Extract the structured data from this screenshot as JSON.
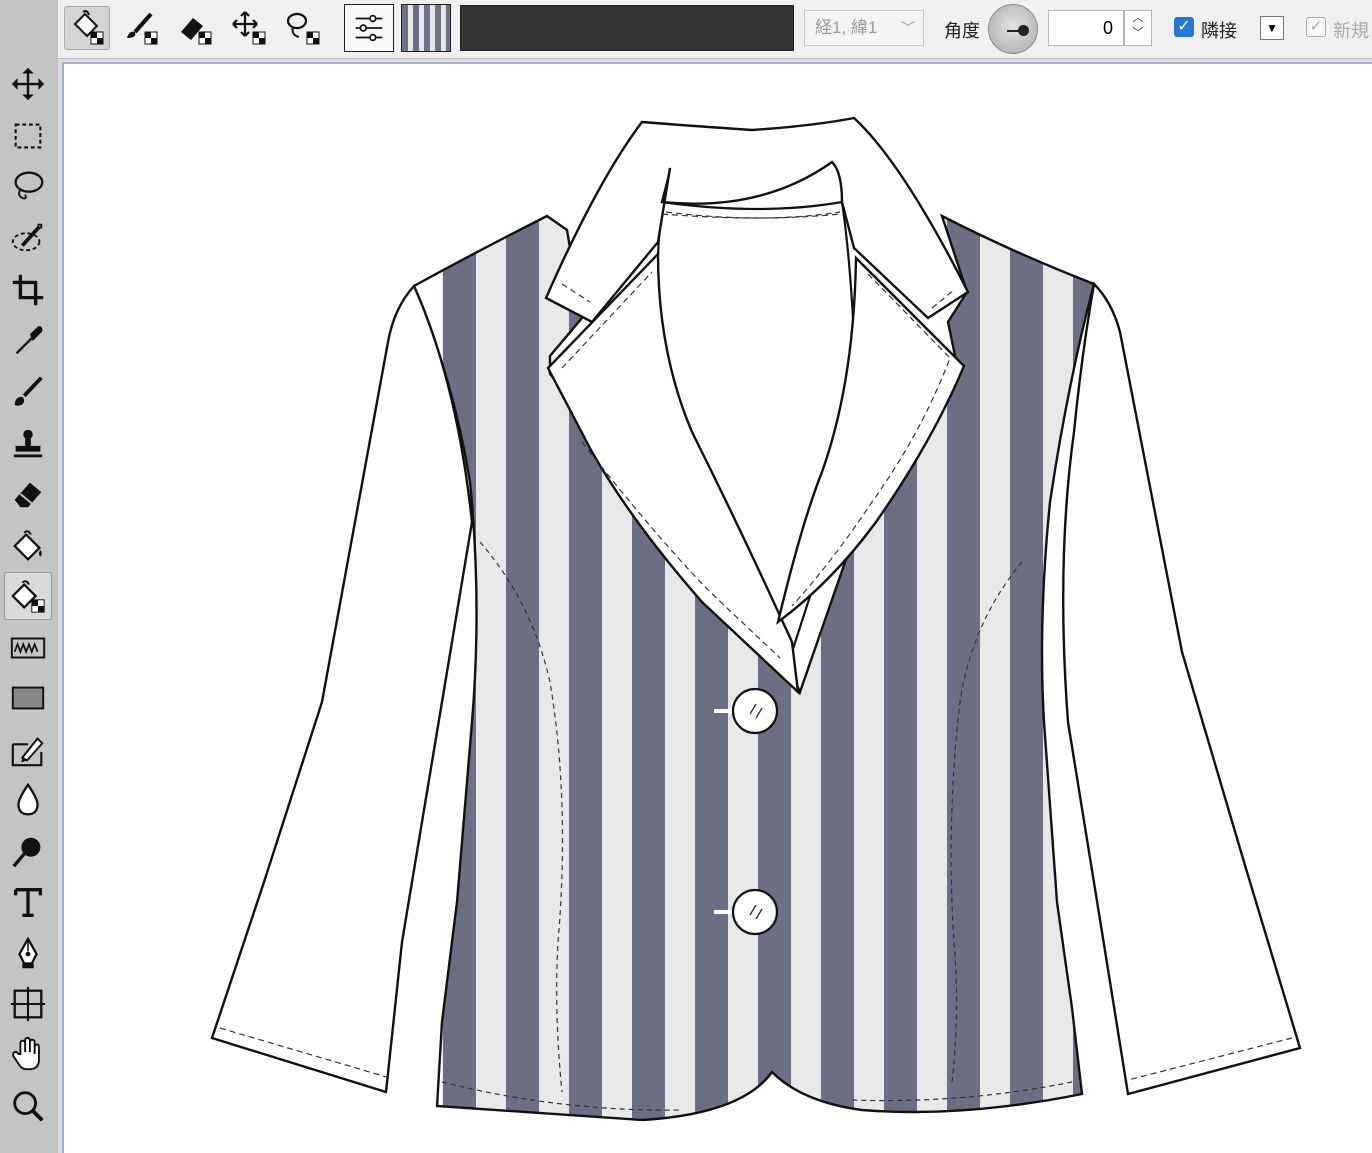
{
  "toolbar": {
    "sampling_value": "経1, 緯1",
    "angle_label": "角度",
    "angle_value": "0",
    "contiguous_label": "隣接",
    "contiguous_checked": true,
    "new_layer_label": "新規",
    "new_layer_checked": true,
    "fill_color": "#333335"
  },
  "tools": [
    "move-icon",
    "rectangle-marquee-icon",
    "lasso-icon",
    "magic-wand-icon",
    "crop-icon",
    "eyedropper-icon",
    "brush-icon",
    "stamp-icon",
    "eraser-icon",
    "paint-bucket-icon",
    "pattern-bucket-icon",
    "wave-icon",
    "rectangle-shape-icon",
    "edit-icon",
    "blur-drop-icon",
    "dodge-icon",
    "text-icon",
    "pen-icon",
    "grid-transform-icon",
    "hand-icon",
    "zoom-icon"
  ],
  "active_tool": "pattern-bucket-icon",
  "artwork": {
    "subject": "jacket-sketch",
    "stripe_dark": "#6c6f82",
    "stripe_light": "#e8e8ea"
  }
}
